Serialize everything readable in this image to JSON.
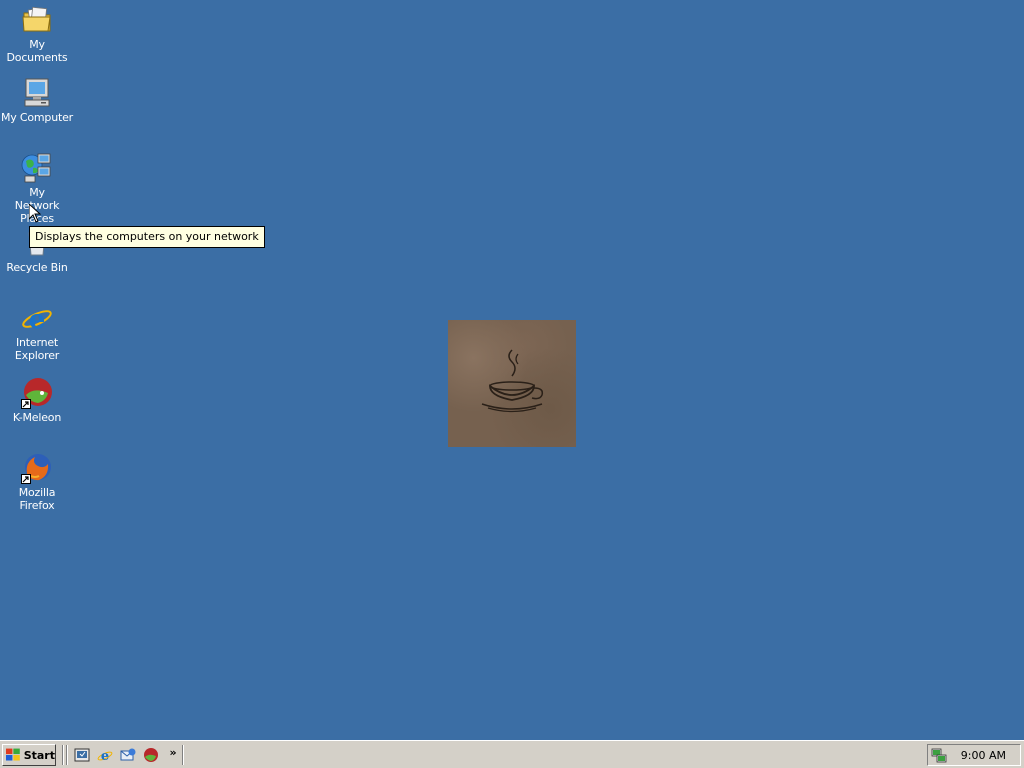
{
  "desktop": {
    "background_color": "#3b6ea5",
    "icons": [
      {
        "label": "My Documents",
        "icon": "folder-documents-icon"
      },
      {
        "label": "My Computer",
        "icon": "computer-icon"
      },
      {
        "label": "My Network Places",
        "icon": "network-places-icon"
      },
      {
        "label": "Recycle Bin",
        "icon": "recycle-bin-icon"
      },
      {
        "label": "Internet Explorer",
        "icon": "internet-explorer-icon"
      },
      {
        "label": "K-Meleon",
        "icon": "k-meleon-icon"
      },
      {
        "label": "Mozilla Firefox",
        "icon": "firefox-icon"
      }
    ],
    "tooltip": "Displays the computers on your network",
    "wallpaper_icon": "coffee-cup-icon"
  },
  "taskbar": {
    "start_label": "Start",
    "quick_launch": [
      {
        "icon": "show-desktop-icon"
      },
      {
        "icon": "internet-explorer-icon"
      },
      {
        "icon": "outlook-express-icon"
      },
      {
        "icon": "k-meleon-icon"
      }
    ],
    "chevron": "»",
    "tray_icon": "network-connection-icon",
    "clock": "9:00 AM"
  }
}
